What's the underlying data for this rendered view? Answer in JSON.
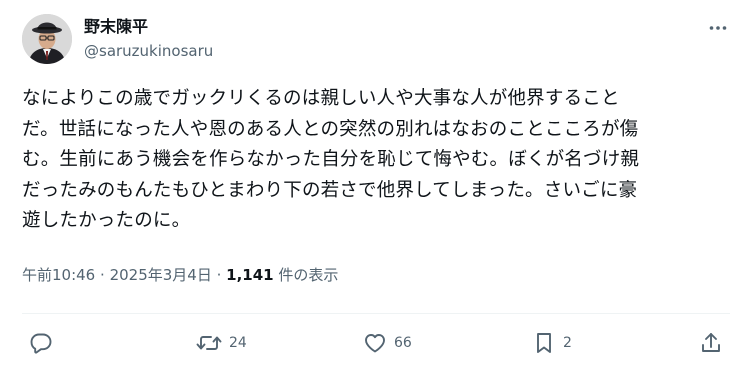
{
  "author": {
    "display_name": "野末陳平",
    "handle": "@saruzukinosaru"
  },
  "tweet": {
    "lines": [
      "なによりこの歳でガックリくるのは親しい人や大事な人が他界すること",
      "だ。世話になった人や恩のある人との突然の別れはなおのことこころが傷",
      "む。生前にあう機会を作らなかった自分を恥じて悔やむ。ぼくが名づけ親",
      "だったみのもんたもひとまわり下の若さで他界してしまった。さいごに豪",
      "遊したかったのに。"
    ]
  },
  "meta": {
    "time": "午前10:46",
    "separator": "·",
    "date": "2025年3月4日",
    "views_count": "1,141",
    "views_label": "件の表示"
  },
  "actions": {
    "replies": "",
    "reposts": "24",
    "likes": "66",
    "bookmarks": "2"
  },
  "icons": {
    "more": "more-icon",
    "reply": "reply-icon",
    "repost": "repost-icon",
    "like": "like-icon",
    "bookmark": "bookmark-icon",
    "share": "share-icon"
  },
  "colors": {
    "text": "#0f1419",
    "secondary": "#536471",
    "divider": "#eff3f4"
  }
}
